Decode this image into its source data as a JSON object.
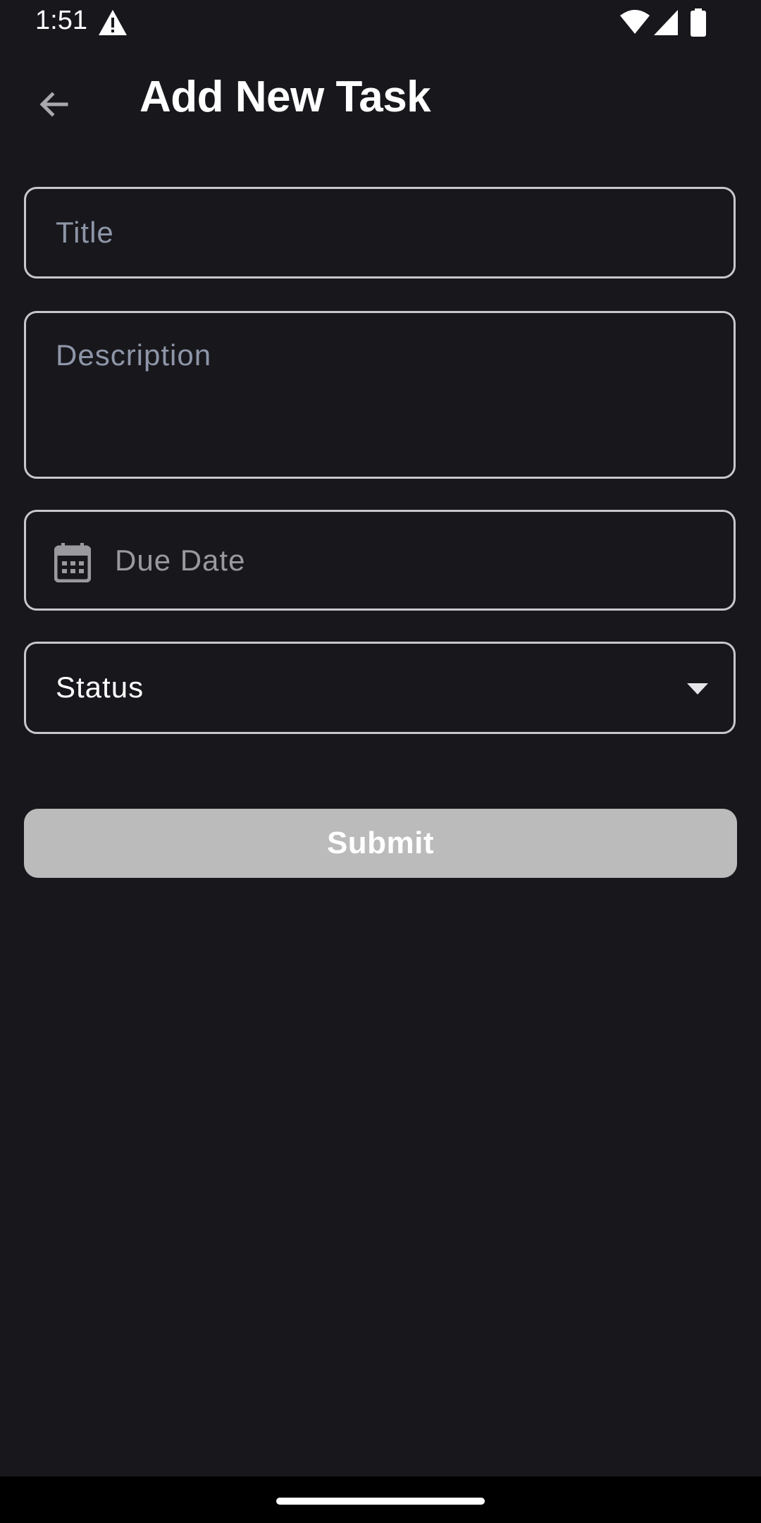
{
  "status_bar": {
    "time": "1:51",
    "icons": [
      "alert-icon",
      "wifi-icon",
      "signal-icon",
      "battery-icon"
    ]
  },
  "app_bar": {
    "back_icon": "arrow-left-icon",
    "title": "Add New Task"
  },
  "form": {
    "title_field": {
      "placeholder": "Title",
      "value": ""
    },
    "description_field": {
      "placeholder": "Description",
      "value": ""
    },
    "due_date_field": {
      "placeholder": "Due Date",
      "value": "",
      "icon": "calendar-icon"
    },
    "status_field": {
      "label": "Status",
      "icon": "dropdown-arrow-icon"
    },
    "submit_label": "Submit"
  },
  "colors": {
    "background": "#18171c",
    "field_border": "#c9c7cc",
    "placeholder": "#8e96a8",
    "submit_disabled": "#bbbbbb"
  }
}
